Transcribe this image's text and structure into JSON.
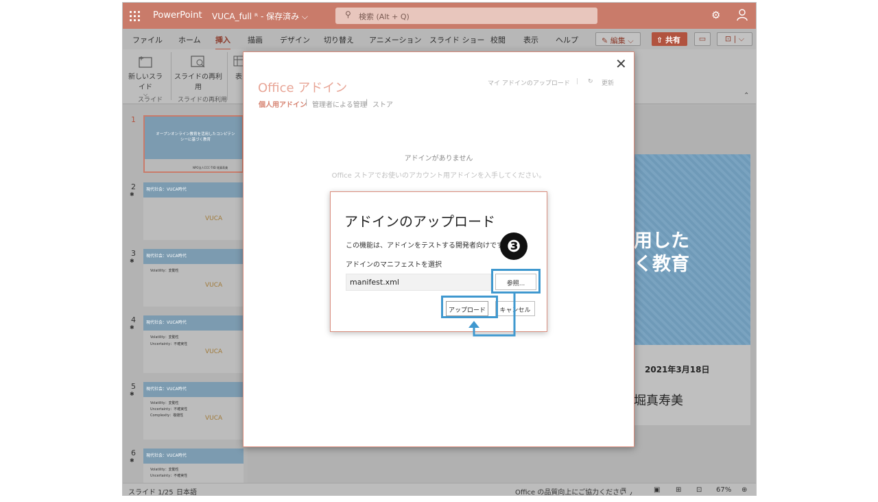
{
  "titlebar": {
    "app_name": "PowerPoint",
    "doc_title": "VUCA_full  ᴿ - 保存済み ⌵",
    "search_placeholder": "検索 (Alt + Q)"
  },
  "ribbon": {
    "tabs": [
      "ファイル",
      "ホーム",
      "挿入",
      "描画",
      "デザイン",
      "切り替え",
      "アニメーション",
      "スライド ショー",
      "校閲",
      "表示",
      "ヘルプ"
    ],
    "active_tab": "挿入",
    "edit_label": "編集 ⌵",
    "share_label": "共有",
    "items": {
      "new_slide": "新しいスライド",
      "reuse_slide": "スライドの再利用",
      "table": "表"
    },
    "groups": {
      "slides": "スライド",
      "reuse": "スライドの再利用"
    }
  },
  "thumbnails": {
    "numbers": [
      "1",
      "2",
      "3",
      "4",
      "5",
      "6"
    ],
    "slide1_title": "オープンオンライン教育を活用したコンピテンシーに基づく教育",
    "slide1_footer": "NPO法人CCC-TIID 堀真寿美",
    "section_title": "現代社会：VUCA時代",
    "vuca_text": "VUCA",
    "bullets": {
      "volatility": "Volatility：変動性",
      "uncertainty": "Uncertainty：不確実性",
      "complexity": "Complexity：複雑性"
    }
  },
  "main_slide": {
    "title_line1": "用した",
    "title_line2": "く教育",
    "date": "2021年3月18日",
    "author": "堀真寿美"
  },
  "status_bar": {
    "slide_info": "スライド 1/25",
    "language": "日本語",
    "feedback": "Office の品質向上にご協力ください",
    "notes": "ノート",
    "zoom": "67%"
  },
  "addin_dialog": {
    "title": "Office アドイン",
    "nav_personal": "個人用アドイン",
    "nav_admin": "管理者による管理",
    "nav_store": "ストア",
    "upload_link": "マイ アドインのアップロード",
    "refresh_link": "更新",
    "empty_title": "アドインがありません",
    "empty_desc": "Office ストアでお使いのアカウント用アドインを入手してください。"
  },
  "upload_dialog": {
    "title": "アドインのアップロード",
    "description": "この機能は、アドインをテストする開発者向けです",
    "manifest_label": "アドインのマニフェストを選択",
    "file_value": "manifest.xml",
    "browse_label": "参照...",
    "upload_label": "アップロード",
    "cancel_label": "キャンセル"
  },
  "annotation": {
    "step_number": "❸",
    "highlight_color": "#3f98cf"
  }
}
